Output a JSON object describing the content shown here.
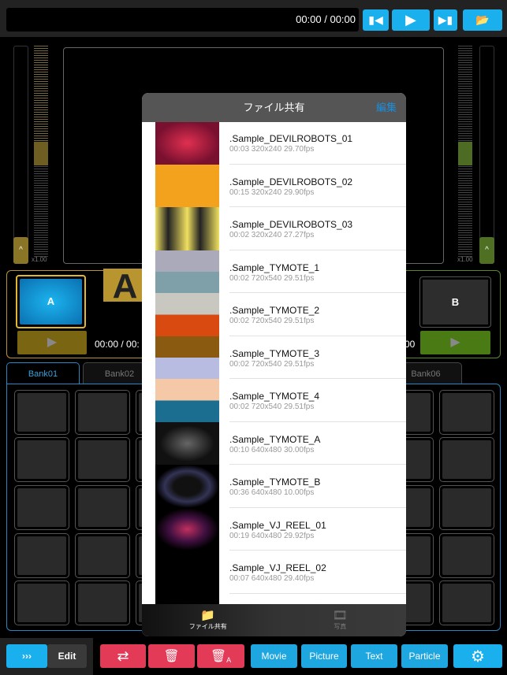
{
  "top": {
    "time": "00:00 / 00:00",
    "prev": "prev-icon",
    "play": "play-icon",
    "next": "next-icon",
    "folder": "folder-music-icon"
  },
  "left_speed": "x1.00",
  "right_speed": "x1.00",
  "deckA": {
    "tile": "A",
    "label": "A",
    "time": "00:00 / 00:",
    "color": "#b8952e"
  },
  "deckB": {
    "tile": "B",
    "time": "00",
    "color": "#5b8a23"
  },
  "banks": [
    "Bank01",
    "Bank02",
    "Bank06"
  ],
  "modal": {
    "title": "ファイル共有",
    "edit": "編集",
    "files": [
      {
        "name": ".Sample_DEVILROBOTS_01",
        "meta": "00:03 320x240 29.70fps"
      },
      {
        "name": ".Sample_DEVILROBOTS_02",
        "meta": "00:15 320x240 29.90fps"
      },
      {
        "name": ".Sample_DEVILROBOTS_03",
        "meta": "00:02 320x240 27.27fps"
      },
      {
        "name": ".Sample_TYMOTE_1",
        "meta": "00:02 720x540 29.51fps"
      },
      {
        "name": ".Sample_TYMOTE_2",
        "meta": "00:02 720x540 29.51fps"
      },
      {
        "name": ".Sample_TYMOTE_3",
        "meta": "00:02 720x540 29.51fps"
      },
      {
        "name": ".Sample_TYMOTE_4",
        "meta": "00:02 720x540 29.51fps"
      },
      {
        "name": ".Sample_TYMOTE_A",
        "meta": "00:10 640x480 30.00fps"
      },
      {
        "name": ".Sample_TYMOTE_B",
        "meta": "00:36 640x480 10.00fps"
      },
      {
        "name": ".Sample_VJ_REEL_01",
        "meta": "00:19 640x480 29.92fps"
      },
      {
        "name": ".Sample_VJ_REEL_02",
        "meta": "00:07 640x480 29.40fps"
      }
    ],
    "tabs": [
      "ファイル共有",
      "写真"
    ]
  },
  "bottom": {
    "expand": "›››",
    "edit": "Edit",
    "swap": "swap-icon",
    "trash": "trash-icon",
    "trash_all": "trash-all-icon",
    "trash_all_sub": "A",
    "movie": "Movie",
    "picture": "Picture",
    "text": "Text",
    "particle": "Particle",
    "settings": "gear-icon"
  }
}
